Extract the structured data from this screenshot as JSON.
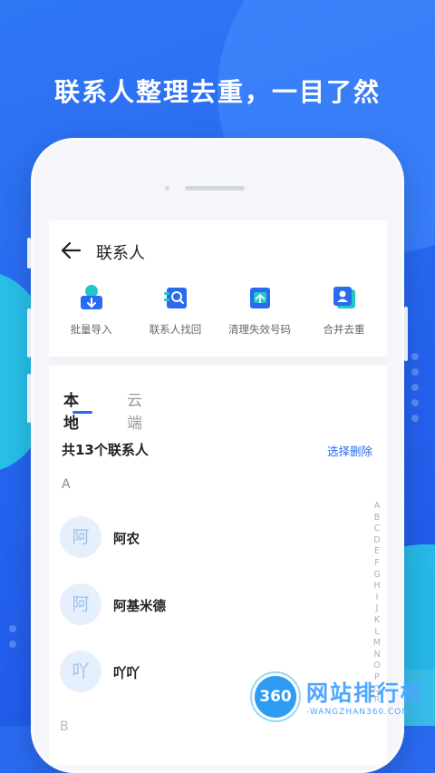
{
  "headline": "联系人整理去重，一目了然",
  "screen": {
    "title": "联系人",
    "actions": [
      {
        "label": "批量导入",
        "icon": "import-icon"
      },
      {
        "label": "联系人找回",
        "icon": "contact-search-icon"
      },
      {
        "label": "清理失效号码",
        "icon": "clean-number-icon"
      },
      {
        "label": "合并去重",
        "icon": "merge-icon"
      }
    ],
    "tabs": [
      "本地",
      "云端"
    ],
    "count_text": "共13个联系人",
    "select_delete": "选择删除",
    "section_letter": "A",
    "contacts": [
      {
        "avatar": "阿",
        "name": "阿农"
      },
      {
        "avatar": "阿",
        "name": "阿基米德"
      },
      {
        "avatar": "吖",
        "name": "吖吖"
      }
    ],
    "next_letter": "B",
    "index_letters": [
      "A",
      "B",
      "C",
      "D",
      "E",
      "F",
      "G",
      "H",
      "I",
      "J",
      "K",
      "L",
      "M",
      "N",
      "O",
      "P",
      "Q",
      "R"
    ]
  },
  "watermark": {
    "badge": "360",
    "text": "网站排行榜",
    "sub": "-WANGZHAN360.COM-"
  },
  "colors": {
    "accent": "#2a6af0",
    "background": "#2563ee",
    "icon_teal": "#22c8c8"
  }
}
